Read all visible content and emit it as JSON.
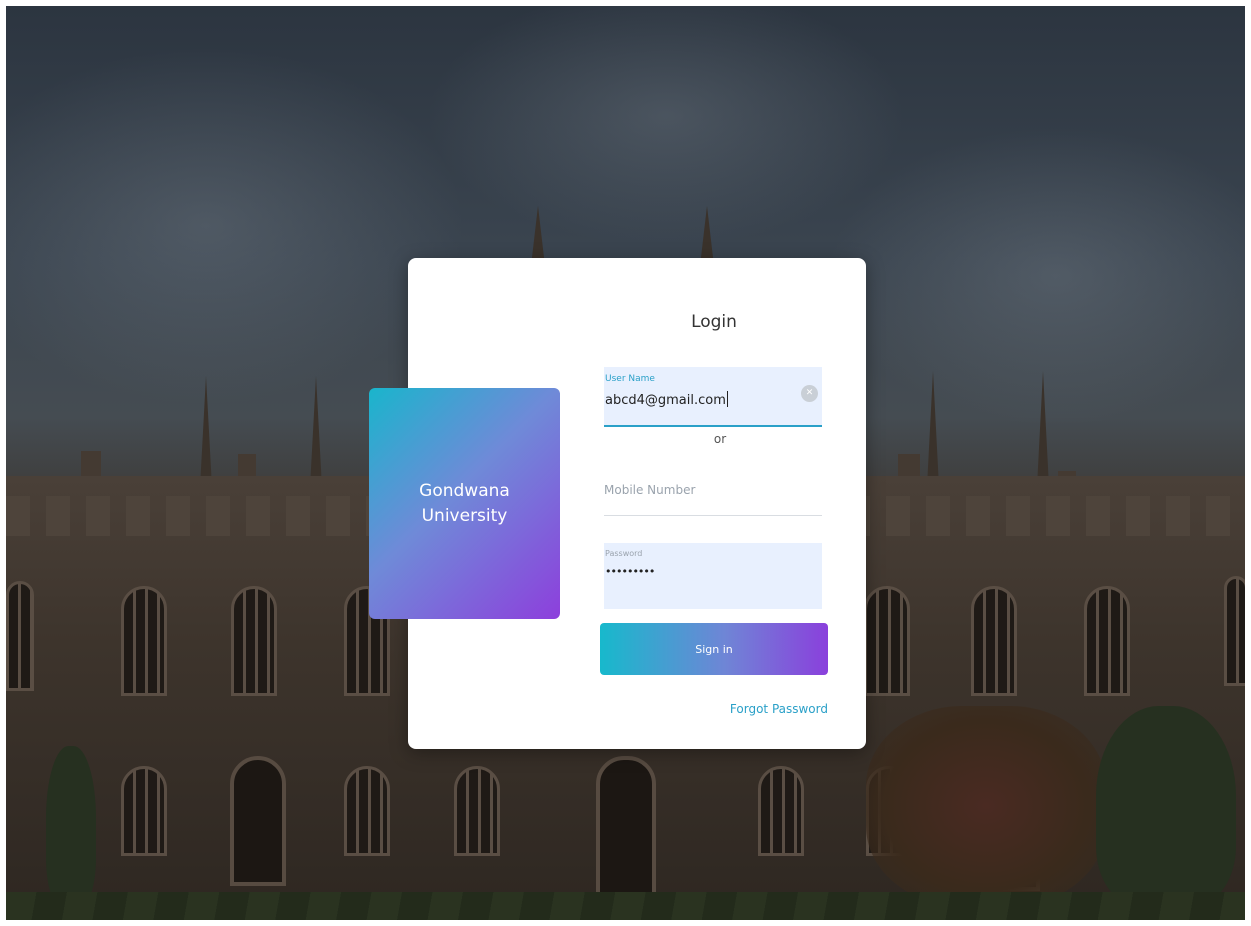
{
  "brand": {
    "line1": "Gondwana",
    "line2": "University"
  },
  "login": {
    "title": "Login",
    "username": {
      "label": "User Name",
      "value": "abcd4@gmail.com",
      "clear_icon": "x-icon"
    },
    "separator": "or",
    "mobile": {
      "placeholder": "Mobile Number"
    },
    "password": {
      "label": "Password",
      "value": "•••••••••"
    },
    "signin_label": "Sign in",
    "forgot_label": "Forgot Password"
  },
  "colors": {
    "accent": "#2aa0c8",
    "gradient_start": "#17b9cc",
    "gradient_end": "#8a40dc",
    "field_bg": "#e8f0fe"
  }
}
